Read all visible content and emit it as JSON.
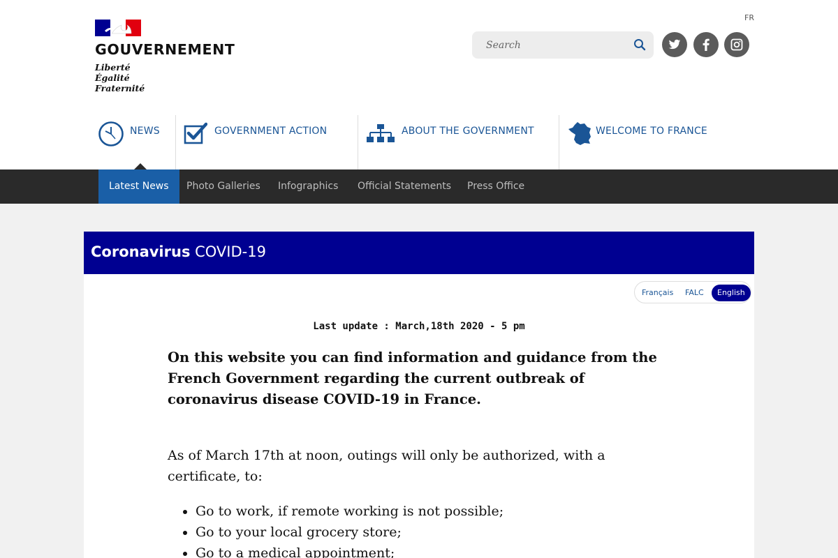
{
  "header": {
    "logo_title": "GOUVERNEMENT",
    "motto": [
      "Liberté",
      "Égalité",
      "Fraternité"
    ],
    "lang_link": "FR",
    "search_placeholder": "Search",
    "social": [
      {
        "name": "twitter-icon"
      },
      {
        "name": "facebook-icon"
      },
      {
        "name": "instagram-icon"
      }
    ]
  },
  "main_nav": [
    {
      "label": "NEWS",
      "icon": "clock-icon"
    },
    {
      "label": "GOVERNMENT ACTION",
      "icon": "checkbox-icon"
    },
    {
      "label": "ABOUT THE GOVERNMENT",
      "icon": "org-chart-icon"
    },
    {
      "label": "WELCOME TO FRANCE",
      "icon": "france-map-icon"
    }
  ],
  "sub_nav": [
    {
      "label": "Latest News",
      "active": true
    },
    {
      "label": "Photo Galleries"
    },
    {
      "label": "Infographics"
    },
    {
      "label": "Official Statements"
    },
    {
      "label": "Press Office"
    }
  ],
  "banner": {
    "bold": "Coronavirus",
    "rest": " COVID-19"
  },
  "language_switch": [
    {
      "label": "Français"
    },
    {
      "label": "FALC"
    },
    {
      "label": "English",
      "active": true
    }
  ],
  "article": {
    "last_update": "Last update : March,18th 2020 - 5 pm",
    "lead": "On this website you can find information and guidance from the French Government regarding the current outbreak of coronavirus disease COVID-19 in France.",
    "intro": "As of March 17th at noon, outings will only be authorized, with a certificate, to:",
    "items": [
      "Go to work, if remote working is not possible;",
      "Go to your local grocery store;",
      "Go to a medical appointment;"
    ]
  },
  "colors": {
    "primary_blue": "#000091",
    "link_blue": "#1a5596",
    "active_tab": "#1a5fa7",
    "subnav_bg": "#2a2a2a",
    "flag_red": "#e1000f"
  }
}
